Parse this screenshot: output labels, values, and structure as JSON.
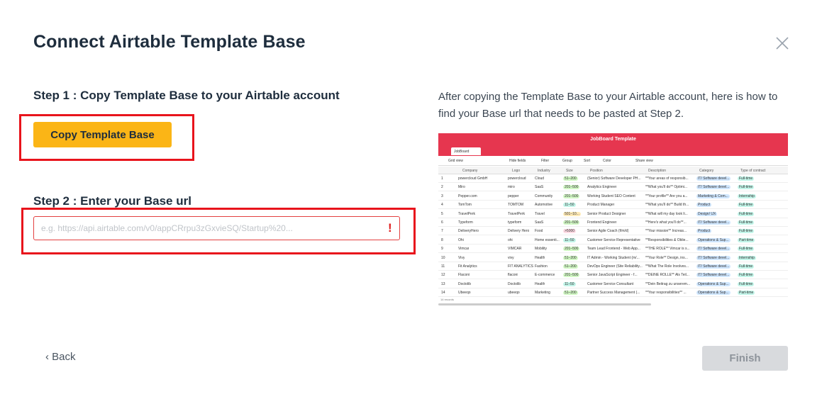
{
  "modal": {
    "title": "Connect Airtable Template Base",
    "close_icon": "close-icon"
  },
  "step1": {
    "heading": "Step 1 : Copy Template Base to your Airtable account",
    "button_label": "Copy Template Base"
  },
  "step2": {
    "heading": "Step 2 : Enter your Base url",
    "input_value": "",
    "input_placeholder": "e.g. https://api.airtable.com/v0/appCRrpu3zGxvieSQ/Startup%20...",
    "error_mark": "!"
  },
  "info": {
    "text": "After copying the Template Base to your Airtable account, here is how to find your Base url that needs to be pasted at Step 2."
  },
  "screenshot": {
    "app_title": "JobBoard Template",
    "tab": "JobBoard",
    "toolbar": [
      "Grid view",
      "Hide fields",
      "Filter",
      "Group",
      "Sort",
      "Color",
      "Share view"
    ],
    "columns": [
      "Company",
      "Logo",
      "Industry",
      "Size",
      "Position",
      "Description",
      "Category",
      "Type of contract"
    ],
    "rows": [
      [
        "1",
        "powercloud GmbH",
        "powercloud",
        "Cloud",
        "51–200",
        "(Senior) Software Developer PH...",
        "**Your areas of responsib...",
        "IT/ Software devel...",
        "Full-time"
      ],
      [
        "2",
        "Miro",
        "miro",
        "SaaS",
        "201–500",
        "Analytics Engineer",
        "**What you'll do** Optimi...",
        "IT/ Software devel...",
        "Full-time"
      ],
      [
        "3",
        "Pepper.com",
        "pepper",
        "Community",
        "201–500",
        "Working Student SEO Content",
        "**Your profile** Are you a...",
        "Marketing & Com...",
        "Internship"
      ],
      [
        "4",
        "TomTom",
        "TOMTOM",
        "Automotive",
        "11–50",
        "Product Manager",
        "**What you'll do** Build th...",
        "Product",
        "Full-time"
      ],
      [
        "5",
        "TravelPerk",
        "TravelPerk",
        "Travel",
        "501–10...",
        "Senior Product Designer",
        "**What will my day look li...",
        "Design/ UX",
        "Full-time"
      ],
      [
        "6",
        "Typeform",
        "typeform",
        "SaaS",
        "201–500",
        "Frontend Engineer",
        "**Here's what you'll do**...",
        "IT/ Software devel...",
        "Full-time"
      ],
      [
        "7",
        "DeliveryHero",
        "Delivery Hero",
        "Food",
        ">5000",
        "Senior Agile Coach (f/m/d)",
        "**Your mission** Increas...",
        "Product",
        "Full-time"
      ],
      [
        "8",
        "Ohi",
        "ohi",
        "Home essenti...",
        "11–50",
        "Customer Service Representative",
        "**Responsibilities & Oblie...",
        "Operations & Sup...",
        "Part-time"
      ],
      [
        "9",
        "Vimcar",
        "VIMCAR",
        "Mobility",
        "201–500",
        "Team Lead Frontend - Web App...",
        "**THE ROLE** Vimcar is s...",
        "IT/ Software devel...",
        "Full-time"
      ],
      [
        "10",
        "Vivy",
        "vivy",
        "Health",
        "51–200",
        "IT Admin - Working Student (m/...",
        "**Your Role** Design, ins...",
        "IT/ Software devel...",
        "Internship"
      ],
      [
        "11",
        "Fit Analytics",
        "FIT ANALYTICS",
        "Fashion",
        "51–200",
        "DevOps Engineer (Site Reliability...",
        "**What The Role Involves...",
        "IT/ Software devel...",
        "Full-time"
      ],
      [
        "12",
        "Flaconi",
        "flaconi",
        "E-commerce",
        "201–500",
        "Senior JavaScript Engineer - f...",
        "**DEINE ROLLE** Als Teil...",
        "IT/ Software devel...",
        "Full-time"
      ],
      [
        "13",
        "Doctolib",
        "Doctolib",
        "Health",
        "11–50",
        "Customer Service Consultant",
        "**Dein Beitrag zu unserem...",
        "Operations & Sup...",
        "Full-time"
      ],
      [
        "14",
        "Ubeeqo",
        "ubeeqo",
        "Marketing",
        "51–200",
        "Partner Success Management (...",
        "**Your responsibilities** ...",
        "Operations & Sup...",
        "Part-time"
      ]
    ],
    "footer": "14 records"
  },
  "footer": {
    "back_label": "Back",
    "back_icon": "chevron-left-icon",
    "finish_label": "Finish"
  },
  "colors": {
    "accent": "#fbb516",
    "airtable_header": "#e6364f",
    "highlight": "#e8141c",
    "text": "#1e2d3d"
  }
}
